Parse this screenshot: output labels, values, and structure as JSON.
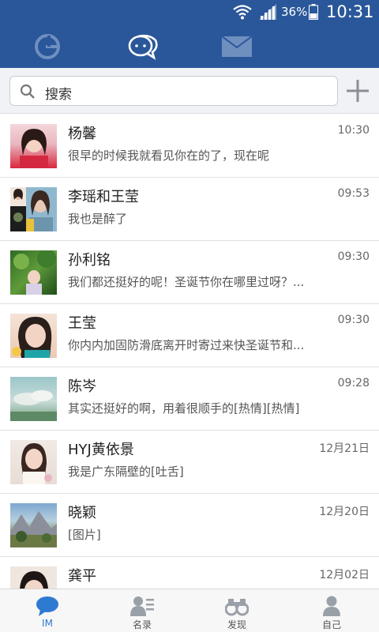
{
  "status_bar": {
    "battery_percent": "36%",
    "time": "10:31"
  },
  "top_nav": {
    "icons": [
      "g-logo-icon",
      "chat-icon",
      "mail-icon"
    ],
    "active": "chat-icon"
  },
  "search": {
    "placeholder": "搜索"
  },
  "conversations": [
    {
      "name": "杨馨",
      "time": "10:30",
      "message": "很早的时候我就看见你在的了，现在呢",
      "avatar": "avatar-pink"
    },
    {
      "name": "李瑶和王莹",
      "time": "09:53",
      "message": "我也是醉了",
      "avatar": "avatar-group"
    },
    {
      "name": "孙利铭",
      "time": "09:30",
      "message": "我们都还挺好的呢！圣诞节你在哪里过呀？...",
      "avatar": "avatar-green"
    },
    {
      "name": "王莹",
      "time": "09:30",
      "message": "你内内加固防滑底离开时寄过来快圣诞节和...",
      "avatar": "avatar-teal"
    },
    {
      "name": "陈岑",
      "time": "09:28",
      "message": "其实还挺好的啊，用着很顺手的[热情][热情]",
      "avatar": "avatar-sky"
    },
    {
      "name": "HYJ黄依景",
      "time": "12月21日",
      "message": "我是广东隔壁的[吐舌]",
      "avatar": "avatar-white"
    },
    {
      "name": "晓颖",
      "time": "12月20日",
      "message": "[图片]",
      "avatar": "avatar-landscape"
    },
    {
      "name": "龚平",
      "time": "12月02日",
      "message": "",
      "avatar": "avatar-dark"
    }
  ],
  "tabs": [
    {
      "label": "IM",
      "icon": "chat-bubble-icon",
      "active": true
    },
    {
      "label": "名录",
      "icon": "contacts-icon",
      "active": false
    },
    {
      "label": "发现",
      "icon": "binoculars-icon",
      "active": false
    },
    {
      "label": "自己",
      "icon": "person-icon",
      "active": false
    }
  ],
  "colors": {
    "header": "#2a579a",
    "accent": "#2f7ad1",
    "background": "#ffffff"
  }
}
